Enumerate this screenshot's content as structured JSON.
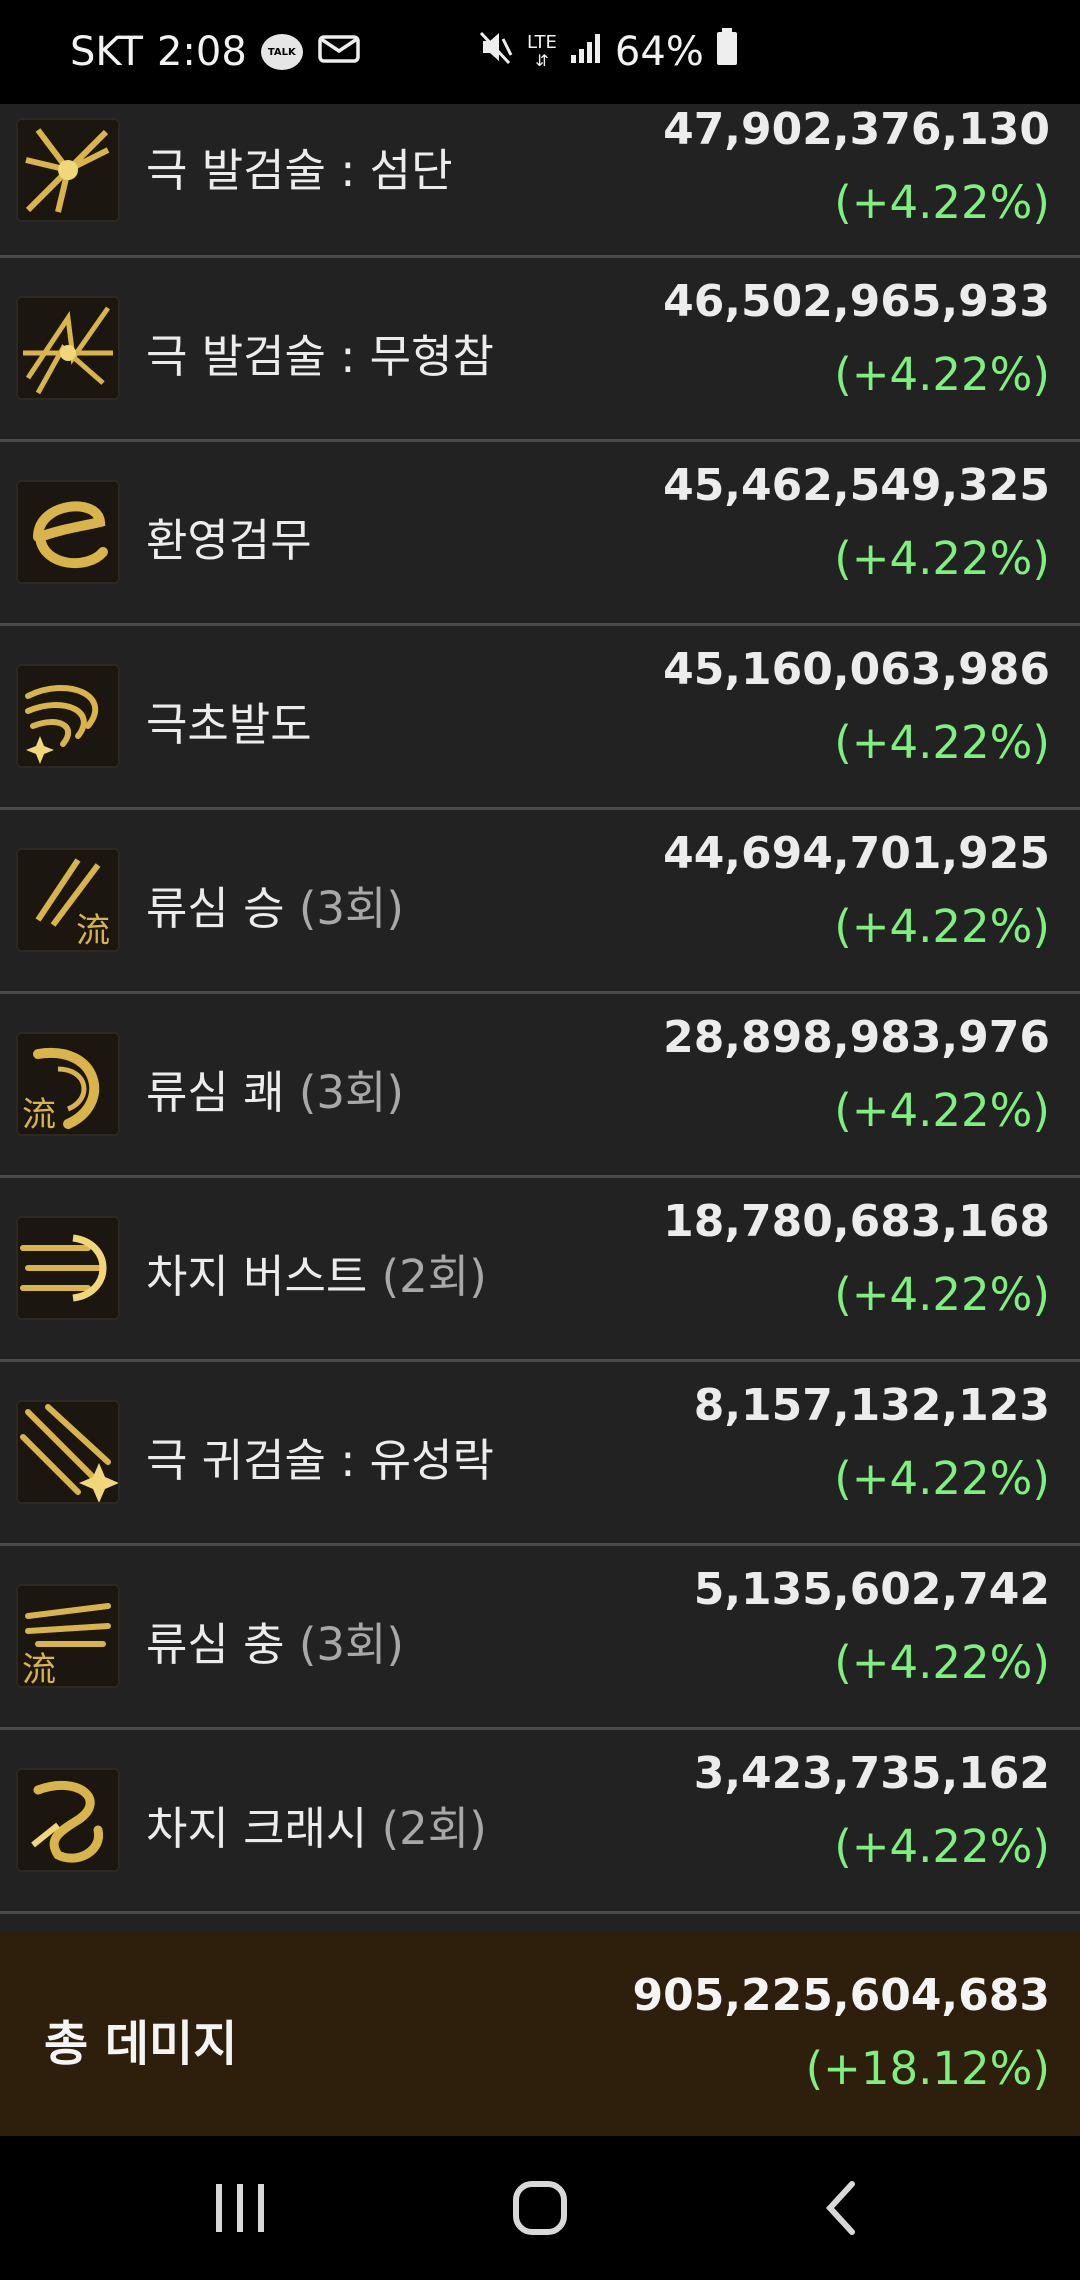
{
  "status_bar": {
    "carrier": "SKT",
    "time": "2:08",
    "talk_badge": "TALK",
    "network": "LTE",
    "battery": "64%",
    "icons": [
      "talk-bubble-icon",
      "mail-icon",
      "mute-icon",
      "lte-icon",
      "signal-icon",
      "battery-icon"
    ]
  },
  "skills": [
    {
      "name": "극 발검술 : 섬단",
      "count": "",
      "damage": "47,902,376,130",
      "change": "(+4.22%)",
      "icon": "sword-burst-icon"
    },
    {
      "name": "극 발검술 : 무형참",
      "count": "",
      "damage": "46,502,965,933",
      "change": "(+4.22%)",
      "icon": "slash-burst-icon"
    },
    {
      "name": "환영검무",
      "count": "",
      "damage": "45,462,549,325",
      "change": "(+4.22%)",
      "icon": "phantom-swirl-icon"
    },
    {
      "name": "극초발도",
      "count": "",
      "damage": "45,160,063,986",
      "change": "(+4.22%)",
      "icon": "draw-wave-icon"
    },
    {
      "name": "류심 승",
      "count": "(3회)",
      "damage": "44,694,701,925",
      "change": "(+4.22%)",
      "icon": "ryusim-rise-icon"
    },
    {
      "name": "류심 쾌",
      "count": "(3회)",
      "damage": "28,898,983,976",
      "change": "(+4.22%)",
      "icon": "ryusim-swift-icon"
    },
    {
      "name": "차지 버스트",
      "count": "(2회)",
      "damage": "18,780,683,168",
      "change": "(+4.22%)",
      "icon": "charge-burst-icon"
    },
    {
      "name": "극 귀검술 : 유성락",
      "count": "",
      "damage": "8,157,132,123",
      "change": "(+4.22%)",
      "icon": "meteor-fall-icon"
    },
    {
      "name": "류심 충",
      "count": "(3회)",
      "damage": "5,135,602,742",
      "change": "(+4.22%)",
      "icon": "ryusim-charge-icon"
    },
    {
      "name": "차지 크래시",
      "count": "(2회)",
      "damage": "3,423,735,162",
      "change": "(+4.22%)",
      "icon": "charge-crash-icon"
    }
  ],
  "icon_glyphs": {
    "ryu": "流"
  },
  "total": {
    "label": "총 데미지",
    "damage": "905,225,604,683",
    "change": "(+18.12%)"
  },
  "colors": {
    "background": "#222222",
    "separator": "#4a4a4a",
    "positive_change": "#7ff07f",
    "total_background": "#2d1f0c",
    "icon_gold": "#d9b44a"
  },
  "nav_bar": {
    "buttons": [
      "recent-apps-icon",
      "home-icon",
      "back-icon"
    ]
  }
}
